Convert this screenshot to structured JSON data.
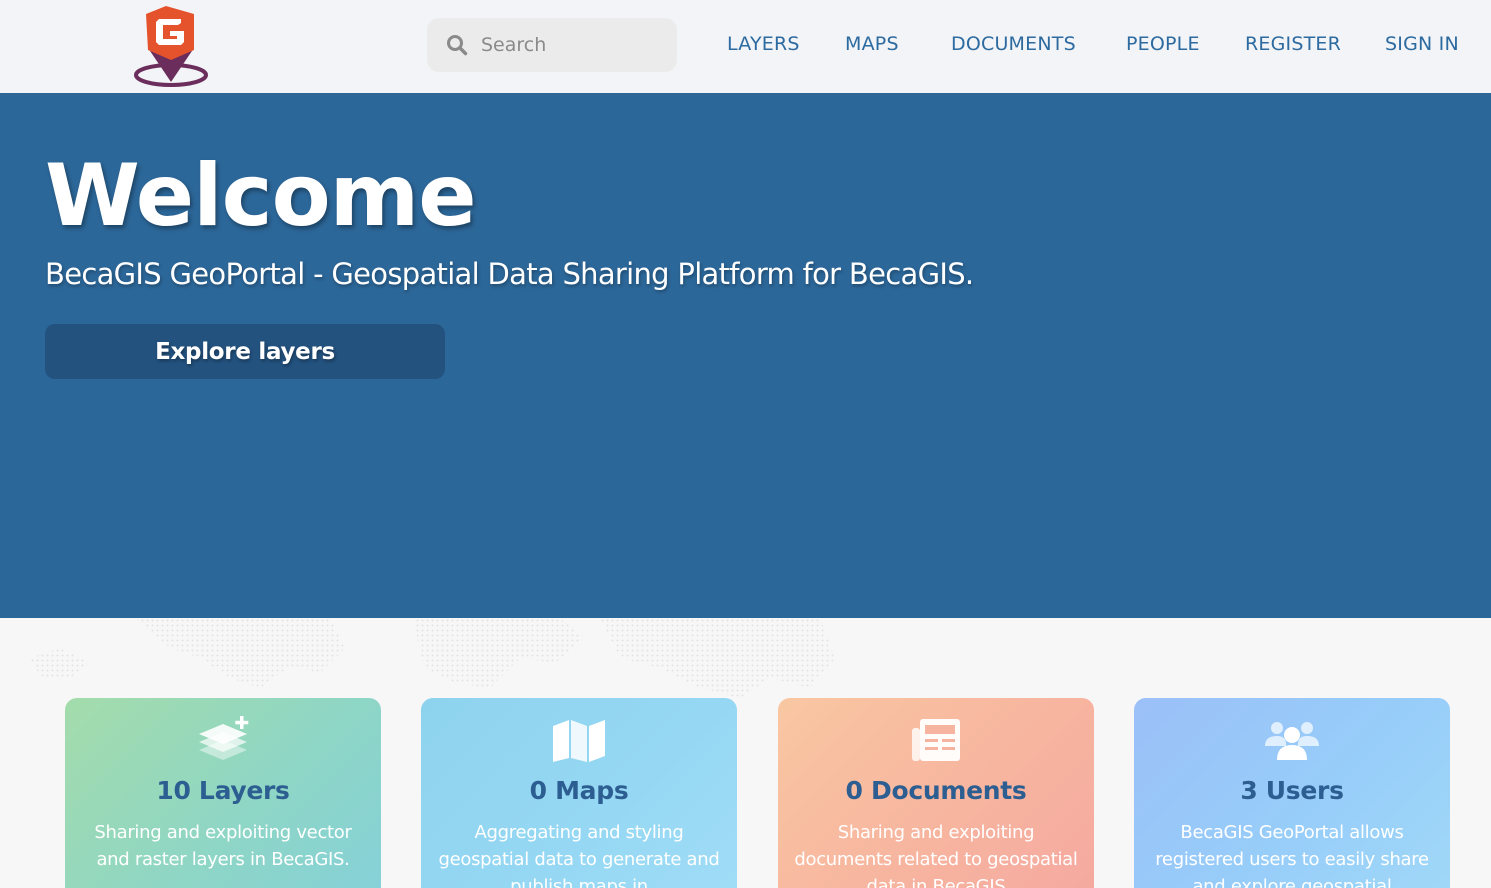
{
  "header": {
    "logo_letter": "G",
    "search": {
      "placeholder": "Search",
      "value": ""
    },
    "nav": [
      {
        "label": "LAYERS"
      },
      {
        "label": "MAPS"
      },
      {
        "label": "DOCUMENTS"
      },
      {
        "label": "PEOPLE"
      },
      {
        "label": "REGISTER"
      },
      {
        "label": "SIGN IN"
      }
    ]
  },
  "hero": {
    "title": "Welcome",
    "subtitle": "BecaGIS GeoPortal - Geospatial Data Sharing Platform for BecaGIS.",
    "button_label": "Explore layers",
    "background_color": "#2c6799"
  },
  "cards": [
    {
      "icon": "layers-add-icon",
      "title": "10 Layers",
      "description": "Sharing and exploiting vector and raster layers in BecaGIS."
    },
    {
      "icon": "map-icon",
      "title": "0 Maps",
      "description": "Aggregating and styling geospatial data to generate and publish maps in"
    },
    {
      "icon": "newspaper-icon",
      "title": "0 Documents",
      "description": "Sharing and exploiting documents related to geospatial data in BecaGIS"
    },
    {
      "icon": "users-icon",
      "title": "3 Users",
      "description": "BecaGIS GeoPortal allows registered users to easily share and explore geospatial"
    }
  ],
  "colors": {
    "nav_text": "#2c6aa0",
    "card_title": "#2c5e91",
    "logo_orange": "#e5532d",
    "logo_purple": "#6b2d5c"
  }
}
